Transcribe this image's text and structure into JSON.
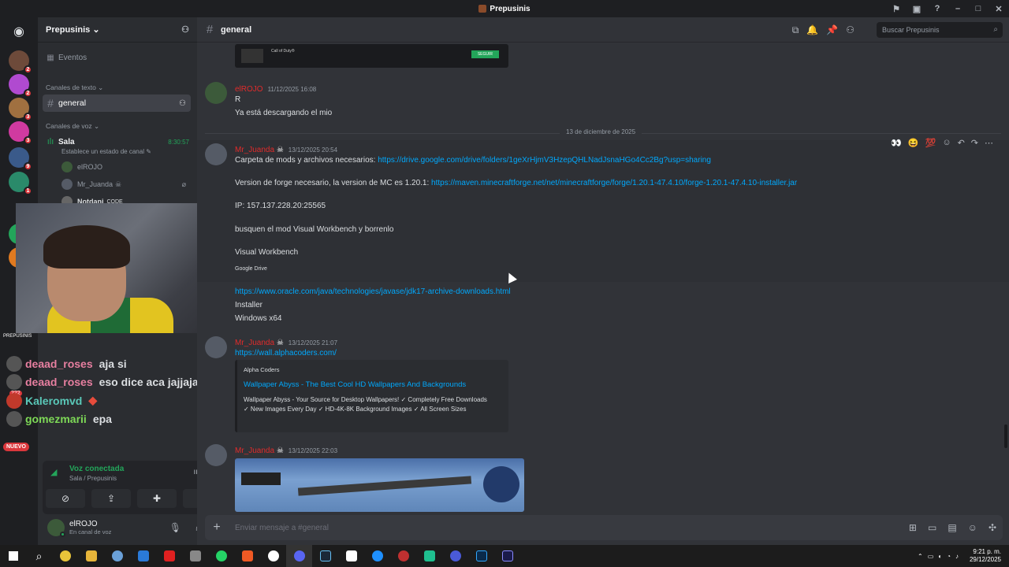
{
  "window": {
    "title": "Prepusinis"
  },
  "guilds": {
    "badges": [
      "2",
      "2",
      "3",
      "3",
      "9",
      "1"
    ],
    "new_label": "NUEVO",
    "stream_label": "PREPUSINIS"
  },
  "sidebar": {
    "server_name": "Prepusinis",
    "events_label": "Eventos",
    "text_category": "Canales de texto",
    "active_channel": "general",
    "voice_category": "Canales de voz",
    "voice_channel": "Sala",
    "voice_timer": "8:30:57",
    "voice_status": "Establece un estado de canal",
    "voice_users": [
      "elROJO",
      "Mr_Juanda",
      "Notdani"
    ],
    "code_tag": "CODE"
  },
  "stream_chat": [
    {
      "name": "deaad_roses",
      "text": "aja si",
      "color": "#e77fa0"
    },
    {
      "name": "deaad_roses",
      "text": "eso dice aca jajjaja",
      "color": "#e77fa0"
    },
    {
      "name": "Kaleromvd",
      "text": "",
      "color": "#5ac8b8"
    },
    {
      "name": "gomezmarii",
      "text": "epa",
      "color": "#7ed957"
    }
  ],
  "stream_badges": [
    "222",
    "909"
  ],
  "voice_panel": {
    "status": "Voz conectada",
    "location": "Sala / Prepusinis"
  },
  "user_panel": {
    "name": "elROJO",
    "status": "En canal de voz"
  },
  "header": {
    "channel": "general",
    "search_placeholder": "Buscar Prepusinis"
  },
  "messages": {
    "embed_top": {
      "title": "Call of Duty®",
      "button": "SEGUIR"
    },
    "m1": {
      "author": "elROJO",
      "time": "11/12/2025 16:08",
      "lines": [
        "R",
        "Ya está descargando el mio"
      ]
    },
    "date_divider": "13 de diciembre de 2025",
    "m2": {
      "author": "Mr_Juanda",
      "time": "13/12/2025 20:54",
      "l1_text": "Carpeta de mods y archivos necesarios: ",
      "l1_link": "https://drive.google.com/drive/folders/1geXrHjmV3HzepQHLNadJsnaHGo4Cc2Bg?usp=sharing",
      "l2_text": "Version de forge necesario, la version de MC es 1.20.1: ",
      "l2_link": "https://maven.minecraftforge.net/net/minecraftforge/forge/1.20.1-47.4.10/forge-1.20.1-47.4.10-installer.jar",
      "l3": "IP: 157.137.228.20:25565",
      "l4": "busquen el mod Visual Workbench y borrenlo",
      "l5": "Visual Workbench",
      "l6": "Google Drive",
      "l7_link": "https://www.oracle.com/java/technologies/javase/jdk17-archive-downloads.html",
      "l8": "Installer",
      "l9": "Windows x64"
    },
    "m3": {
      "author": "Mr_Juanda",
      "time": "13/12/2025 21:07",
      "link": "https://wall.alphacoders.com/",
      "embed_provider": "Alpha Coders",
      "embed_title": "Wallpaper Abyss - The Best Cool HD Wallpapers And Backgrounds",
      "embed_desc": "Wallpaper Abyss - Your Source for Desktop Wallpapers! ✓ Completely Free Downloads ✓ New Images Every Day ✓ HD-4K-8K Background Images ✓ All Screen Sizes"
    },
    "m4": {
      "author": "Mr_Juanda",
      "time": "13/12/2025 22:03"
    }
  },
  "composer": {
    "placeholder": "Enviar mensaje a #general"
  },
  "taskbar": {
    "time": "9:21 p. m.",
    "date": "29/12/2025"
  }
}
